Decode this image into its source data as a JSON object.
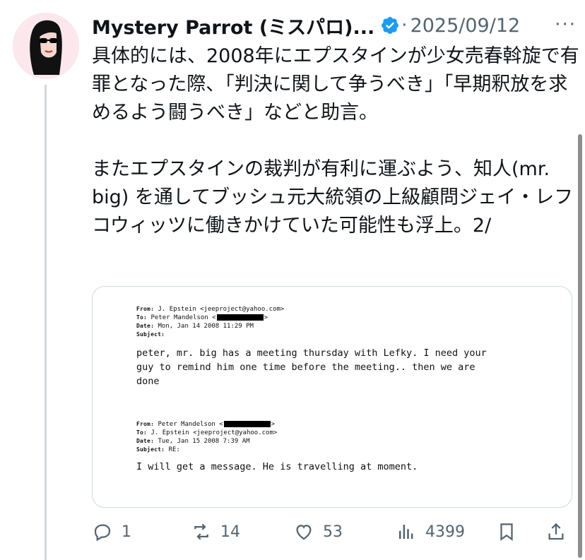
{
  "post": {
    "author_name": "Mystery Parrot (ミスパロ)...",
    "separator": "·",
    "date": "2025/09/12",
    "more_label": "···",
    "text": "具体的には、2008年にエプスタインが少女売春斡旋で有罪となった際、「判決に関して争うべき」「早期釈放を求めるよう闘うべき」などと助言。\n\nまたエプスタインの裁判が有利に運ぶよう、知人(mr. big) を通してブッシュ元大統領の上級顧問ジェイ・レフコウィッツに働きかけていた可能性も浮上。2/"
  },
  "email1": {
    "from_label": "From:",
    "from_value": "J. Epstein <jeeproject@yahoo.com>",
    "to_label": "To:",
    "to_value": "Peter Mandelson <",
    "to_suffix": ">",
    "date_label": "Date:",
    "date_value": "Mon, Jan 14 2008 11:29 PM",
    "subject_label": "Subject:",
    "subject_value": "",
    "body": "peter, mr. big has a meeting thursday with Lefky. I need your\nguy to remind him one time before the meeting.. then we are\ndone"
  },
  "email2": {
    "from_label": "From:",
    "from_value": "Peter Mandelson <",
    "from_suffix": ">",
    "to_label": "To:",
    "to_value": "J. Epstein <jeeproject@yahoo.com>",
    "date_label": "Date:",
    "date_value": "Tue, Jan 15 2008 7:39 AM",
    "subject_label": "Subject:",
    "subject_value": "RE:",
    "body": "I will get a message. He is travelling at moment."
  },
  "actions": {
    "replies": "1",
    "reposts": "14",
    "likes": "53",
    "views": "4399"
  },
  "colors": {
    "verified_blue": "#1d9bf0",
    "muted": "#536471",
    "border": "#cfd9de"
  },
  "icons": [
    "avatar-illustration",
    "verified-badge-icon",
    "more-icon",
    "reply-icon",
    "repost-icon",
    "like-icon",
    "views-icon",
    "bookmark-icon",
    "share-icon"
  ]
}
